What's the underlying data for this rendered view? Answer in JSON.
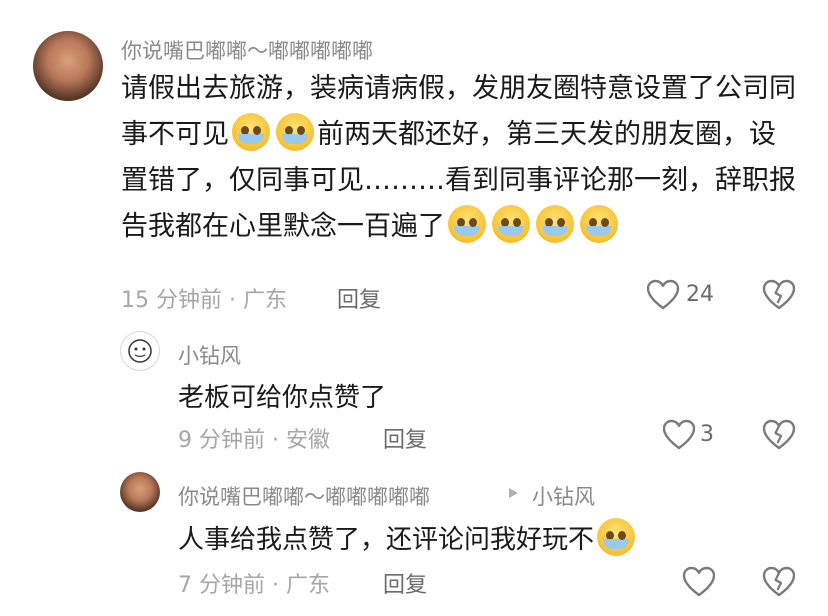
{
  "comment": {
    "username": "你说嘴巴嘟嘟～嘟嘟嘟嘟嘟",
    "text_parts": [
      "请假出去旅游，装病请病假，发朋友圈特意设置了公司同事不可见",
      "前两天都还好，第三天发的朋友圈，设置错了，仅同事可见………看到同事评论那一刻，辞职报告我都在心里默念一百遍了"
    ],
    "time_location": "15 分钟前 · 广东",
    "reply_label": "回复",
    "like_count": "24"
  },
  "replies": [
    {
      "username": "小钻风",
      "text": "老板可给你点赞了",
      "time_location": "9 分钟前 · 安徽",
      "reply_label": "回复",
      "like_count": "3"
    },
    {
      "username": "你说嘴巴嘟嘟～嘟嘟嘟嘟嘟",
      "reply_to": "小钻风",
      "text": "人事给我点赞了，还评论问我好玩不",
      "time_location": "7 分钟前 · 广东",
      "reply_label": "回复"
    }
  ],
  "icons": {
    "like": "heart-outline-icon",
    "dislike": "broken-heart-icon",
    "reply_arrow": "triangle-right-icon",
    "emoji": "pleading-face-emoji"
  },
  "colors": {
    "username": "#8a8a8a",
    "text": "#1a1a1a",
    "meta": "#a6a6a6",
    "icon": "#7a7a7a"
  }
}
